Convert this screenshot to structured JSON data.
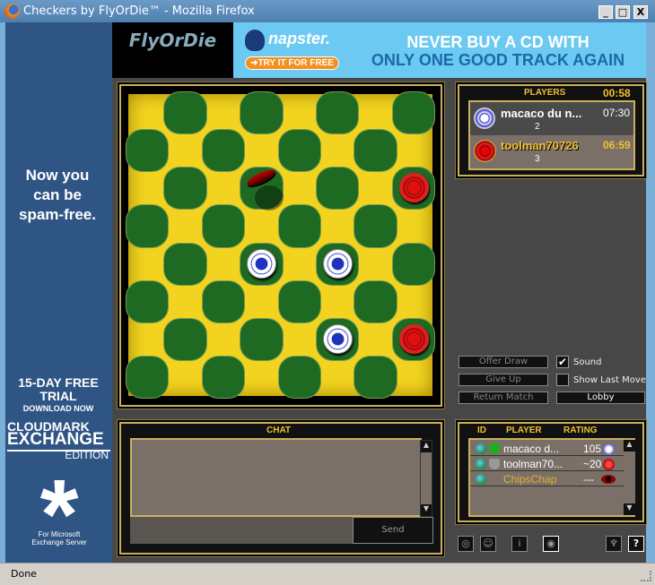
{
  "window": {
    "title": "Checkers by FlyOrDie™ - Mozilla Firefox",
    "minimize": "_",
    "maximize": "□",
    "close": "X"
  },
  "left_ad": {
    "headline": "Now you can be spam-free.",
    "trial": "15-DAY FREE TRIAL",
    "download": "DOWNLOAD NOW",
    "brand": "CLOUDMARK",
    "product": "EXCHANGE",
    "edition": "EDITION",
    "footer": "For Microsoft Exchange Server"
  },
  "banner": {
    "logo": "FlyOrDie",
    "napster": "napster.",
    "cta": "➜TRY IT FOR FREE",
    "line1": "NEVER BUY A CD WITH",
    "line2": "ONLY ONE GOOD TRACK AGAIN"
  },
  "board": {
    "size": 8,
    "pieces": [
      {
        "color": "red",
        "row": 2,
        "col": 7
      },
      {
        "color": "blue",
        "row": 4,
        "col": 3
      },
      {
        "color": "blue",
        "row": 4,
        "col": 5
      },
      {
        "color": "blue",
        "row": 6,
        "col": 5
      },
      {
        "color": "red",
        "row": 6,
        "col": 7
      }
    ],
    "dragging": {
      "color": "red",
      "row": 2,
      "col": 3
    }
  },
  "players": {
    "header": "PLAYERS",
    "turn_timer": "00:58",
    "list": [
      {
        "name": "macaco du n...",
        "score": "2",
        "time": "07:30",
        "color": "blue"
      },
      {
        "name": "toolman70726",
        "score": "3",
        "time": "06:59",
        "color": "red"
      }
    ]
  },
  "controls": {
    "offer_draw": "Offer Draw",
    "give_up": "Give Up",
    "return_match": "Return Match",
    "lobby": "Lobby",
    "sound": "Sound",
    "sound_checked": true,
    "show_last_move": "Show Last Move",
    "show_last_move_checked": false
  },
  "chat": {
    "header": "CHAT",
    "send": "Send",
    "input": ""
  },
  "roster": {
    "headers": {
      "id": "ID",
      "player": "PLAYER",
      "rating": "RATING"
    },
    "rows": [
      {
        "name": "macaco d...",
        "rating": "105"
      },
      {
        "name": "toolman70...",
        "rating": "~20"
      },
      {
        "name": "ChipsChap",
        "rating": "---"
      }
    ]
  },
  "statusbar": {
    "text": "Done"
  },
  "colors": {
    "board_yellow": "#f2d420",
    "board_green": "#1f6a22",
    "panel_gold": "#f0c030"
  }
}
